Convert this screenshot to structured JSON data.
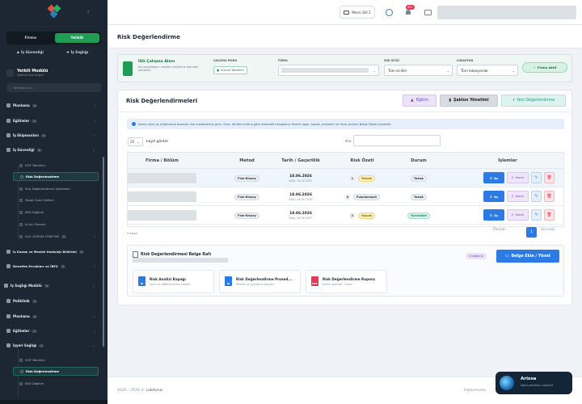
{
  "sidebar": {
    "role_tabs": [
      "Firma",
      "Yetkili"
    ],
    "sub_tabs": [
      "İş Güvenliği",
      "İş Sağlığı"
    ],
    "module_title": "Yetkili Modülü",
    "module_subtitle": "İşletme hızlı erişim",
    "search_placeholder": "Menüde ara...",
    "items": {
      "planlama1": "Planlama",
      "planlama1_count": "4",
      "egitimler1": "Eğitimler",
      "egitimler1_count": "1",
      "ekipmanlari": "İş Ekipmanları",
      "ekipmanlari_count": "3",
      "is_guvenligi": "İş Güvenliği",
      "is_guvenligi_count": "8",
      "dof": "DÖF Yönetimi",
      "risk": "Risk Değerlendirme",
      "risk_sablon": "Risk Değerlendirme Şablonları",
      "tespit": "Tespit Öneri Defteri",
      "kkd": "KKD Dağıtım",
      "is_izin": "İş İzin Sistemi",
      "acil": "ACİL DURUM YÖNETİMİ",
      "acil_count": "2",
      "kaza": "İş Kazası ve Meslek Hastalığı Bildirimi",
      "kaza_count": "2",
      "denetim": "Denetim Evrakları ve İBYS",
      "denetim_count": "3",
      "is_sagligi": "İş Sağlığı Modülü",
      "is_sagligi_count": "6",
      "poliklinik": "Poliklinik",
      "poliklinik_count": "4",
      "planlama2": "Planlama",
      "planlama2_count": "4",
      "egitimler2": "Eğitimler",
      "egitimler2_count": "1",
      "isyeri": "İşyeri Sağlığı",
      "isyeri_count": "3",
      "dof2": "DÖF Yönetimi",
      "risk2": "Risk Değerlendirme",
      "kkd2": "KKD Dağıtım"
    }
  },
  "topbar": {
    "menu_style": "Menü Stil 2",
    "notif_badge": "99+"
  },
  "page": {
    "title": "Risk Değerlendirme"
  },
  "filter": {
    "title": "İSG Çalışma Alanı",
    "desc": "Kurumsallaştırır yönetim verilerine işlemleri yürütülür.",
    "mode_label": "ÇALIŞMA MODU",
    "mode_value": "Kurum Yönetimi",
    "firma_label": "FİRMA",
    "sgk_label": "SGK SİCİLİ",
    "sgk_value": "Tüm siciller",
    "lok_label": "LOKASYON",
    "lok_value": "Tüm lokasyonlar",
    "active_btn": "Firma aktif"
  },
  "card": {
    "title": "Risk Değerlendirmeleri",
    "btn_egitim": "Eğitim",
    "btn_sablon": "Şablon Yönetimi",
    "btn_yeni": "+ Yeni Değerlendirme",
    "info": "Satıra veya Aç düğmesine basarak risk maddelerine girin. Süre, tehlike sınıfına göre otomatik hesaplanır. Resmî rapor, kapak, prosedür ve imza çıktıları Belge Paketi içindedir.",
    "len_value": "25",
    "len_label": "kayıt göster",
    "search_label": "Ara:",
    "count": "3 kayıt",
    "prev": "Önceki",
    "page": "1",
    "next": "Sonraki"
  },
  "table": {
    "headers": [
      "Firma / Bölüm",
      "Metod",
      "Tarih / Geçerlilik",
      "Risk Özeti",
      "Durum",
      "İşlemler"
    ],
    "rows": [
      {
        "method": "Fine-Kinney",
        "date": "18.06.2026",
        "valid": "Bitiş: 18.06.2032",
        "risk_n": "1",
        "risk_label": "Yüksek",
        "risk_kind": "y",
        "status": "Taslak",
        "status_kind": "t"
      },
      {
        "method": "Fine-Kinney",
        "date": "18.06.2026",
        "valid": "Bitiş: 18.06.2030",
        "risk_n": "0",
        "risk_label": "Puanlanmadı",
        "risk_kind": "p",
        "status": "Taslak",
        "status_kind": "t"
      },
      {
        "method": "Fine-Kinney",
        "date": "18.06.2026",
        "valid": "Bitiş: 18.06.2027",
        "risk_n": "2",
        "risk_label": "Yüksek",
        "risk_kind": "y",
        "status": "Yürürlükte",
        "status_kind": "y"
      }
    ],
    "act_open": "Aç",
    "act_print": "Yazdır"
  },
  "shelf": {
    "title": "Risk Değerlendirmesi Belge Rafı",
    "badge": "0 bağlantı",
    "btn": "Belge Ekle / Yönet",
    "docs": [
      {
        "title": "Risk Analizi Kapağı",
        "sub": "İşyeri ve değerlendirme bilgileri",
        "type": "W"
      },
      {
        "title": "Risk Değerlendirme Prosed...",
        "sub": "Yöntem ve uygulama esasları",
        "type": "W"
      },
      {
        "title": "Risk Değerlendirme Raporu",
        "sub": "Kalem işlemleri · imzalı",
        "type": "PDF"
      }
    ]
  },
  "footer": {
    "left": "2020 - 2026 ©",
    "brand": "LabXonic",
    "right": "Hakkımızda"
  },
  "assistant": {
    "name": "Arissa",
    "sub": "Nasıl yardımcı olayım?"
  }
}
